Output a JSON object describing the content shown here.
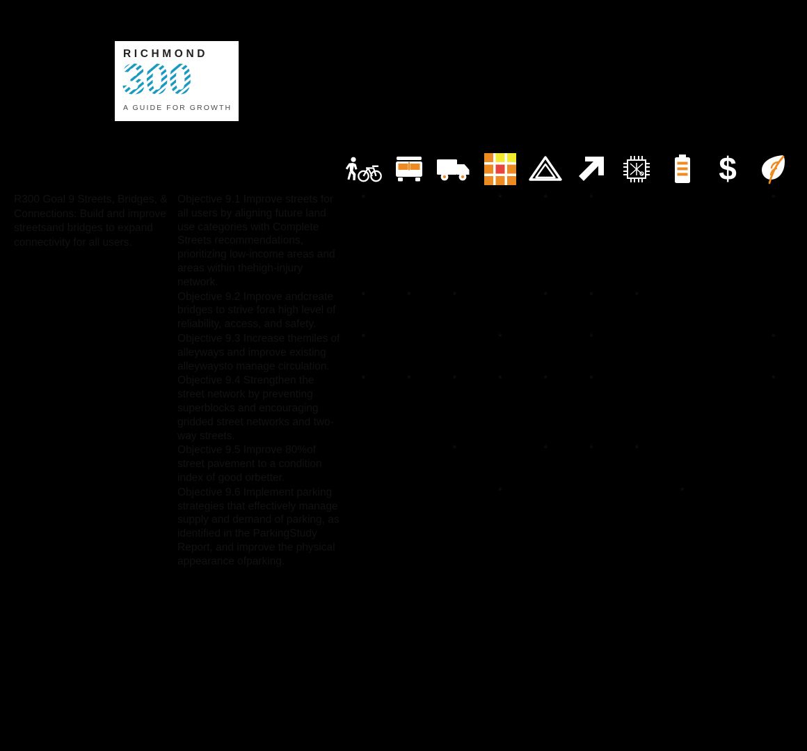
{
  "logo": {
    "brand": "RICHMOND",
    "number": "300",
    "tagline": "A GUIDE FOR GROWTH"
  },
  "colors": {
    "accent_orange": "#ED8B22",
    "cell_blue": "#9FD9F6",
    "background": "#000000",
    "logo_teal": "#1B9AC0",
    "icon_yellow": "#F5EB2E",
    "icon_red": "#E8453C"
  },
  "columns": [
    {
      "key": "ped_bike",
      "icon": "pedestrian-bicycle-icon",
      "label": "Pedestrian & Bicycle"
    },
    {
      "key": "transit",
      "icon": "bus-icon",
      "label": "Transit"
    },
    {
      "key": "freight",
      "icon": "truck-icon",
      "label": "Freight"
    },
    {
      "key": "land_use",
      "icon": "land-use-grid-icon",
      "label": "Land Use"
    },
    {
      "key": "safety",
      "icon": "safety-triangle-icon",
      "label": "Safety"
    },
    {
      "key": "growth",
      "icon": "up-right-arrow-icon",
      "label": "Growth"
    },
    {
      "key": "technology",
      "icon": "microchip-icon",
      "label": "Technology"
    },
    {
      "key": "energy",
      "icon": "battery-icon",
      "label": "Energy"
    },
    {
      "key": "funding",
      "icon": "dollar-sign-icon",
      "label": "Funding"
    },
    {
      "key": "environment",
      "icon": "leaf-icon",
      "label": "Environment"
    }
  ],
  "goal": {
    "text": "R300 Goal 9 Streets, Bridges, & Connections: Build and improve streetsand bridges to expand connectivity for all users."
  },
  "mark_symbol": "*",
  "rows": [
    {
      "objective": "Objective 9.1 Improve streets for all users by aligning future land use categories with Complete Streets recommendations, prioritizing low-income areas and areas within thehigh-injury network.",
      "marks": [
        true,
        false,
        false,
        true,
        true,
        true,
        false,
        false,
        false,
        true
      ]
    },
    {
      "objective": "Objective 9.2 Improve andcreate bridges to strive fora high level of reliability, access, and safety.",
      "marks": [
        true,
        true,
        true,
        false,
        true,
        true,
        true,
        false,
        false,
        false
      ]
    },
    {
      "objective": "Objective 9.3 Increase themiles of alleyways and improve existing alleywaysto manage circulation.",
      "marks": [
        true,
        false,
        false,
        true,
        false,
        true,
        false,
        false,
        false,
        true
      ]
    },
    {
      "objective": "Objective 9.4 Strengthen the street network by preventing superblocks and encouraging gridded street networks and two-way streets.",
      "marks": [
        true,
        true,
        true,
        true,
        true,
        true,
        false,
        false,
        false,
        true
      ]
    },
    {
      "objective": "Objective 9.5 Improve 80%of street pavement to a condition index of good orbetter.",
      "marks": [
        false,
        false,
        true,
        false,
        true,
        true,
        true,
        false,
        false,
        false
      ]
    },
    {
      "objective": "Objective 9.6 Implement parking strategies that effectively manage supply and demand of parking, as identified in the ParkingStudy Report, and improve the physical appearance ofparking.",
      "marks": [
        false,
        false,
        false,
        true,
        false,
        false,
        false,
        true,
        false,
        false
      ]
    }
  ]
}
